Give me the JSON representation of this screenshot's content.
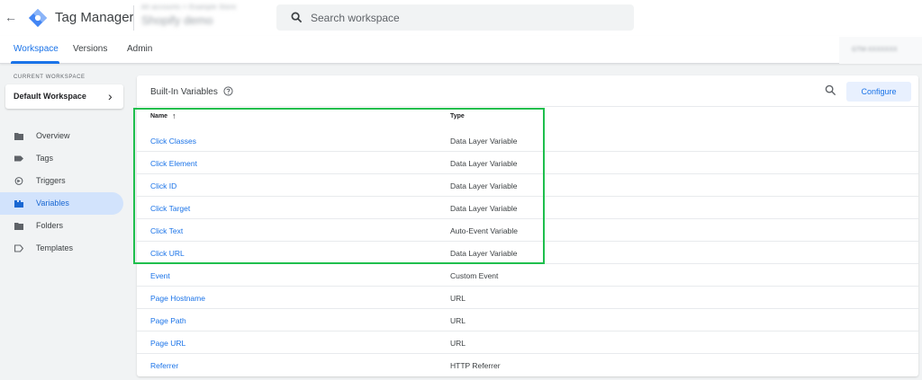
{
  "app": {
    "back_glyph": "←",
    "logo_icon": "tag-manager-logo",
    "title": "Tag Manager",
    "account_line": "All accounts > Example Store",
    "container_name": "Shopify demo",
    "search_placeholder": "Search workspace"
  },
  "tabs": [
    {
      "label": "Workspace",
      "active": true
    },
    {
      "label": "Versions",
      "active": false
    },
    {
      "label": "Admin",
      "active": false
    }
  ],
  "container_id": "GTM-XXXXXXX",
  "sidebar": {
    "current_workspace_label": "CURRENT WORKSPACE",
    "workspace_name": "Default Workspace",
    "chevron": "›",
    "items": [
      {
        "label": "Overview",
        "icon": "overview-icon",
        "active": false
      },
      {
        "label": "Tags",
        "icon": "tag-icon",
        "active": false
      },
      {
        "label": "Triggers",
        "icon": "trigger-icon",
        "active": false
      },
      {
        "label": "Variables",
        "icon": "variables-icon",
        "active": true
      },
      {
        "label": "Folders",
        "icon": "folder-icon",
        "active": false
      },
      {
        "label": "Templates",
        "icon": "template-icon",
        "active": false
      }
    ]
  },
  "main": {
    "title": "Built-In Variables",
    "configure_label": "Configure",
    "columns": {
      "name": "Name",
      "type": "Type"
    },
    "sort_arrow": "↑",
    "rows": [
      {
        "name": "Click Classes",
        "type": "Data Layer Variable"
      },
      {
        "name": "Click Element",
        "type": "Data Layer Variable"
      },
      {
        "name": "Click ID",
        "type": "Data Layer Variable"
      },
      {
        "name": "Click Target",
        "type": "Data Layer Variable"
      },
      {
        "name": "Click Text",
        "type": "Auto-Event Variable"
      },
      {
        "name": "Click URL",
        "type": "Data Layer Variable"
      },
      {
        "name": "Event",
        "type": "Custom Event"
      },
      {
        "name": "Page Hostname",
        "type": "URL"
      },
      {
        "name": "Page Path",
        "type": "URL"
      },
      {
        "name": "Page URL",
        "type": "URL"
      },
      {
        "name": "Referrer",
        "type": "HTTP Referrer"
      }
    ]
  },
  "colors": {
    "accent": "#1a73e8",
    "highlight": "#1fbf4d",
    "active_nav": "#d2e3fc"
  }
}
